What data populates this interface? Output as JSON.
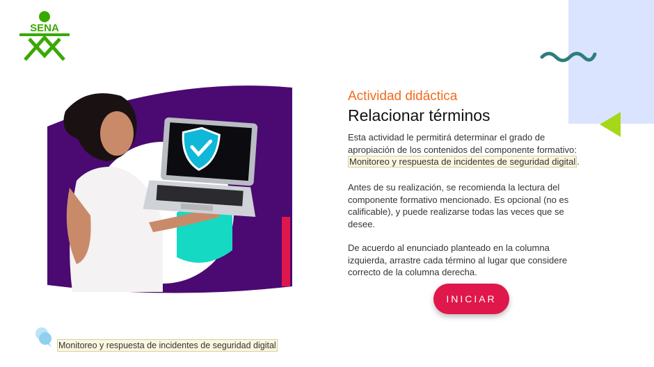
{
  "brand": {
    "logo_text": "SENA",
    "color": "#39a900"
  },
  "activity": {
    "label": "Actividad didáctica",
    "title": "Relacionar términos"
  },
  "description": {
    "p1_text": "Esta actividad le permitirá determinar el grado de apropiación de los contenidos del componente formativo: ",
    "p1_link": "Monitoreo y respuesta de incidentes de seguridad digital",
    "p1_end": ".",
    "p2": "Antes de su realización, se recomienda la lectura del componente formativo mencionado. Es opcional (no es calificable), y puede realizarse todas las veces que se desee.",
    "p3": "De acuerdo al enunciado planteado en la columna izquierda, arrastre cada término al lugar que considere correcto de la columna derecha."
  },
  "start_button": {
    "label": "INICIAR"
  },
  "footer": {
    "link": "Monitoreo y respuesta de incidentes de seguridad digital"
  },
  "colors": {
    "accent_orange": "#f26a1b",
    "button": "#e0174a",
    "panel": "#dbe4ff",
    "purple": "#4a0a72",
    "teal": "#2e7d7a",
    "lime": "#a6d81a"
  },
  "icons": [
    "sena-logo",
    "squiggle-decoration",
    "triangle-decoration",
    "shield-check-icon",
    "chat-bubble-icon"
  ]
}
